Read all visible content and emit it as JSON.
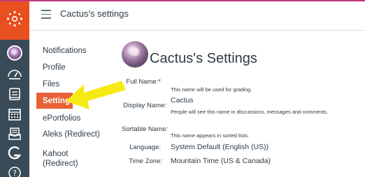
{
  "header": {
    "title": "Cactus's settings"
  },
  "left_nav": {
    "items": [
      {
        "label": "Notifications"
      },
      {
        "label": "Profile"
      },
      {
        "label": "Files"
      },
      {
        "label": "Settings",
        "active": true
      },
      {
        "label": "ePortfolios"
      },
      {
        "label": "Aleks (Redirect)"
      },
      {
        "label": "Kahoot (Redirect)"
      }
    ]
  },
  "profile": {
    "heading": "Cactus's Settings",
    "fields": {
      "full_name": {
        "label": "Full Name:*",
        "value": "",
        "hint": "This name will be used for grading."
      },
      "display_name": {
        "label": "Display Name:",
        "value": "Cactus",
        "hint": "People will see this name in discussions, messages and comments."
      },
      "sortable_name": {
        "label": "Sortable Name:",
        "value": "",
        "hint": "This name appears in sorted lists."
      },
      "language": {
        "label": "Language:",
        "value": "System Default (English (US))"
      },
      "time_zone": {
        "label": "Time Zone:",
        "value": "Mountain Time (US & Canada)"
      }
    }
  },
  "colors": {
    "brand": "#e8501f",
    "rail": "#394b58",
    "active_nav": "#e66135",
    "annotation_arrow": "#f5ea12",
    "top_accent": "#c0397a"
  },
  "icons": {
    "rail": [
      "canvas-logo-icon",
      "user-avatar-icon",
      "dashboard-icon",
      "courses-icon",
      "calendar-icon",
      "inbox-icon",
      "studio-icon",
      "help-icon"
    ],
    "header": [
      "hamburger-menu-icon"
    ]
  }
}
